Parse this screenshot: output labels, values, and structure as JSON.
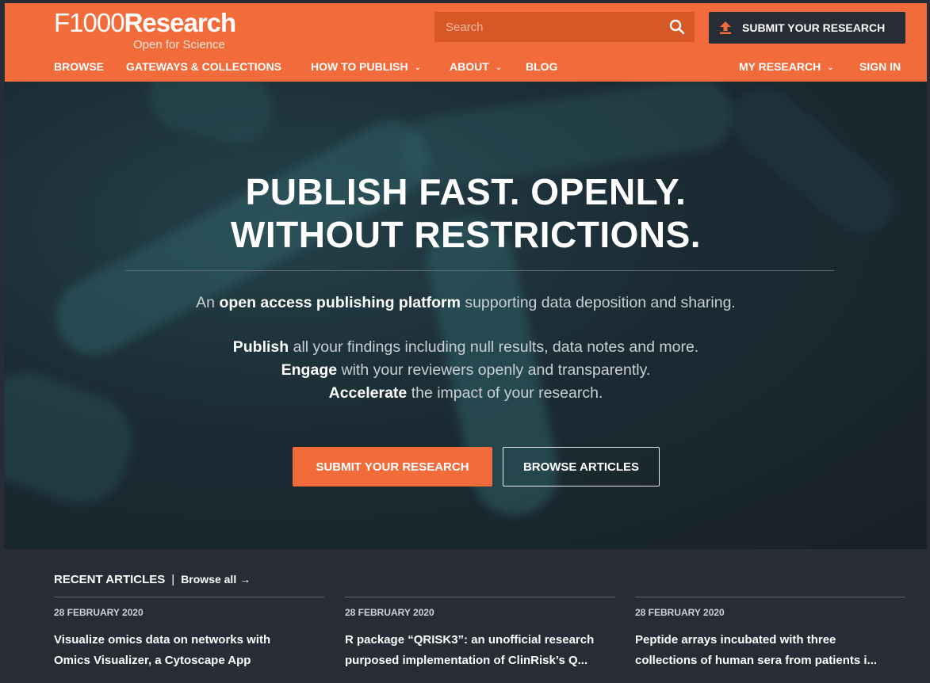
{
  "brand": {
    "name_prefix": "F1000",
    "name_suffix": "Research",
    "tagline": "Open for Science"
  },
  "search": {
    "placeholder": "Search",
    "value": ""
  },
  "header": {
    "submit_label": "SUBMIT YOUR RESEARCH"
  },
  "nav": {
    "browse": "BROWSE",
    "gateways": "GATEWAYS & COLLECTIONS",
    "how_to_publish": "HOW TO PUBLISH",
    "about": "ABOUT",
    "blog": "BLOG",
    "my_research": "MY RESEARCH",
    "sign_in": "SIGN IN"
  },
  "hero": {
    "title_line1": "PUBLISH FAST. OPENLY.",
    "title_line2": "WITHOUT RESTRICTIONS.",
    "intro_prefix": "An",
    "intro_bold": "open access publishing platform",
    "intro_rest": "supporting data deposition and sharing.",
    "point1_bold": "Publish",
    "point1_rest": "all your findings including null results, data notes and more.",
    "point2_bold": "Engage",
    "point2_rest": "with your reviewers openly and transparently.",
    "point3_bold": "Accelerate",
    "point3_rest": "the impact of your research.",
    "primary_button": "SUBMIT YOUR RESEARCH",
    "secondary_button": "BROWSE ARTICLES"
  },
  "recent": {
    "heading": "RECENT ARTICLES",
    "separator": "|",
    "browse_all": "Browse all →",
    "articles": [
      {
        "date": "28 FEBRUARY 2020",
        "title_line1": "Visualize omics data on networks with",
        "title_line2": "Omics Visualizer, a Cytoscape App"
      },
      {
        "date": "28 FEBRUARY 2020",
        "title_line1": "R package “QRISK3”: an unofficial research",
        "title_line2": "purposed implementation of ClinRisk’s Q..."
      },
      {
        "date": "28 FEBRUARY 2020",
        "title_line1": "Peptide arrays incubated with three",
        "title_line2": "collections of human sera from patients i..."
      }
    ]
  },
  "colors": {
    "brand_orange": "#f26b3a",
    "dark_navy": "#272c36",
    "search_bg": "#d75727"
  }
}
